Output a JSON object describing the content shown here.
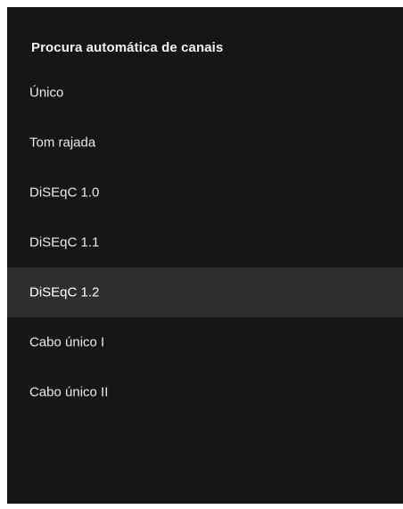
{
  "menu": {
    "title": "Procura automática de canais",
    "selected_index": 4,
    "colors": {
      "background": "#161616",
      "selected_background": "#2e2e2e",
      "text": "#e8e8e8"
    },
    "items": [
      {
        "label": "Único"
      },
      {
        "label": "Tom rajada"
      },
      {
        "label": "DiSEqC 1.0"
      },
      {
        "label": "DiSEqC 1.1"
      },
      {
        "label": "DiSEqC 1.2"
      },
      {
        "label": "Cabo único I"
      },
      {
        "label": "Cabo único II"
      }
    ]
  }
}
